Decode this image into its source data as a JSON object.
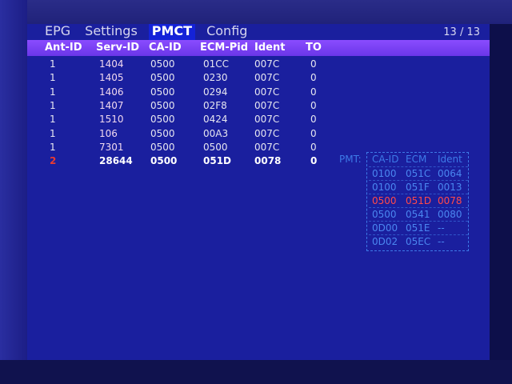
{
  "tabs": [
    "EPG",
    "Settings",
    "PMCT",
    "Config"
  ],
  "active_tab": "PMCT",
  "pager": "13 / 13",
  "table": {
    "columns": [
      "Ant-ID",
      "Serv-ID",
      "CA-ID",
      "ECM-Pid",
      "Ident",
      "TO"
    ],
    "rows": [
      {
        "ant": "1",
        "serv": "1404",
        "ca": "0500",
        "ecm": "01CC",
        "ident": "007C",
        "to": "0"
      },
      {
        "ant": "1",
        "serv": "1405",
        "ca": "0500",
        "ecm": "0230",
        "ident": "007C",
        "to": "0"
      },
      {
        "ant": "1",
        "serv": "1406",
        "ca": "0500",
        "ecm": "0294",
        "ident": "007C",
        "to": "0"
      },
      {
        "ant": "1",
        "serv": "1407",
        "ca": "0500",
        "ecm": "02F8",
        "ident": "007C",
        "to": "0"
      },
      {
        "ant": "1",
        "serv": "1510",
        "ca": "0500",
        "ecm": "0424",
        "ident": "007C",
        "to": "0"
      },
      {
        "ant": "1",
        "serv": "106",
        "ca": "0500",
        "ecm": "00A3",
        "ident": "007C",
        "to": "0"
      },
      {
        "ant": "1",
        "serv": "7301",
        "ca": "0500",
        "ecm": "0500",
        "ident": "007C",
        "to": "0"
      },
      {
        "ant": "2",
        "serv": "28644",
        "ca": "0500",
        "ecm": "051D",
        "ident": "0078",
        "to": "0"
      }
    ]
  },
  "pmt": {
    "label": "PMT:",
    "columns": [
      "CA-ID",
      "ECM",
      "Ident"
    ],
    "rows": [
      {
        "ca": "0100",
        "ecm": "051C",
        "ident": "0064"
      },
      {
        "ca": "0100",
        "ecm": "051F",
        "ident": "0013"
      },
      {
        "ca": "0500",
        "ecm": "051D",
        "ident": "0078"
      },
      {
        "ca": "0500",
        "ecm": "0541",
        "ident": "0080"
      },
      {
        "ca": "0D00",
        "ecm": "051E",
        "ident": "--"
      },
      {
        "ca": "0D02",
        "ecm": "05EC",
        "ident": "--"
      }
    ],
    "active_row": 2
  }
}
